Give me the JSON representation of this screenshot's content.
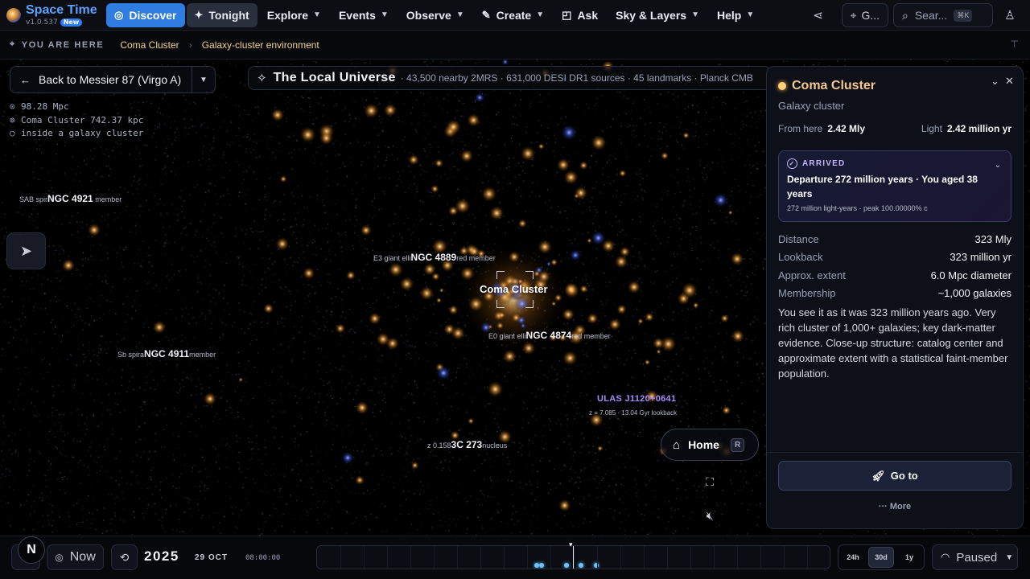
{
  "app": {
    "name": "Space Time",
    "version": "v1.0.537",
    "badge": "New"
  },
  "nav": {
    "discover": "Discover",
    "tonight": "Tonight",
    "explore": "Explore",
    "events": "Events",
    "observe": "Observe",
    "create": "Create",
    "ask": "Ask",
    "sky_layers": "Sky & Layers",
    "help": "Help",
    "goto_short": "G...",
    "search_placeholder": "Sear...",
    "search_kbd": "⌘K"
  },
  "breadcrumb": {
    "label": "YOU ARE HERE",
    "items": [
      "Coma Cluster",
      "Galaxy-cluster environment"
    ]
  },
  "back_button": "Back to Messier 87 (Virgo A)",
  "title_strip": {
    "title": "The Local Universe",
    "subtitle": "· 43,500 nearby 2MRS · 631,000 DESI DR1 sources · 45 landmarks · Planck CMB"
  },
  "hud": {
    "lines": [
      "98.28 Mpc",
      "Coma Cluster 742.37 kpc",
      "inside a galaxy cluster"
    ]
  },
  "sky_labels": {
    "ngc4921": {
      "prefix": "SAB spir",
      "name": "NGC 4921",
      "suffix": " member"
    },
    "ngc4889": {
      "prefix": "E3 giant elli",
      "name": "NGC 4889",
      "suffix": "red member"
    },
    "coma": "Coma Cluster",
    "ngc4874": {
      "prefix": "E0 giant elli",
      "name": "NGC 4874",
      "suffix": "red member"
    },
    "ngc4911": {
      "prefix": "Sb spira",
      "name": "NGC 4911",
      "suffix": "member"
    },
    "quasar": {
      "name": "ULAS J1120+0641",
      "detail": "z = 7.085 · 13.04 Gyr lookback"
    },
    "3c273": {
      "prefix": "z 0.158",
      "name": "3C 273",
      "suffix": "nucleus"
    }
  },
  "home": {
    "label": "Home",
    "kbd": "R"
  },
  "panel": {
    "title": "Coma Cluster",
    "type": "Galaxy cluster",
    "from_here_label": "From here",
    "from_here_value": "2.42 Mly",
    "light_label": "Light",
    "light_value": "2.42 million yr",
    "arrived": {
      "label": "ARRIVED",
      "main": "Departure 272 million years · You aged 38 years",
      "sub": "272 million light-years · peak 100.00000% c"
    },
    "stats": [
      {
        "k": "Distance",
        "v": "323 Mly"
      },
      {
        "k": "Lookback",
        "v": "323 million yr"
      },
      {
        "k": "Approx. extent",
        "v": "6.0 Mpc diameter"
      },
      {
        "k": "Membership",
        "v": "~1,000 galaxies"
      }
    ],
    "description": "You see it as it was 323 million years ago. Very rich cluster of 1,000+ galaxies; key dark-matter evidence. Close-up structure: catalog center and approximate extent with a statistical faint-member population.",
    "goto": "Go to",
    "more": "More"
  },
  "bottom": {
    "compass": "N",
    "now": "Now",
    "year": "2025",
    "date": "29 OCT",
    "time": "08:00:00",
    "ranges": [
      "24h",
      "30d",
      "1y"
    ],
    "active_range": "30d",
    "paused": "Paused"
  }
}
